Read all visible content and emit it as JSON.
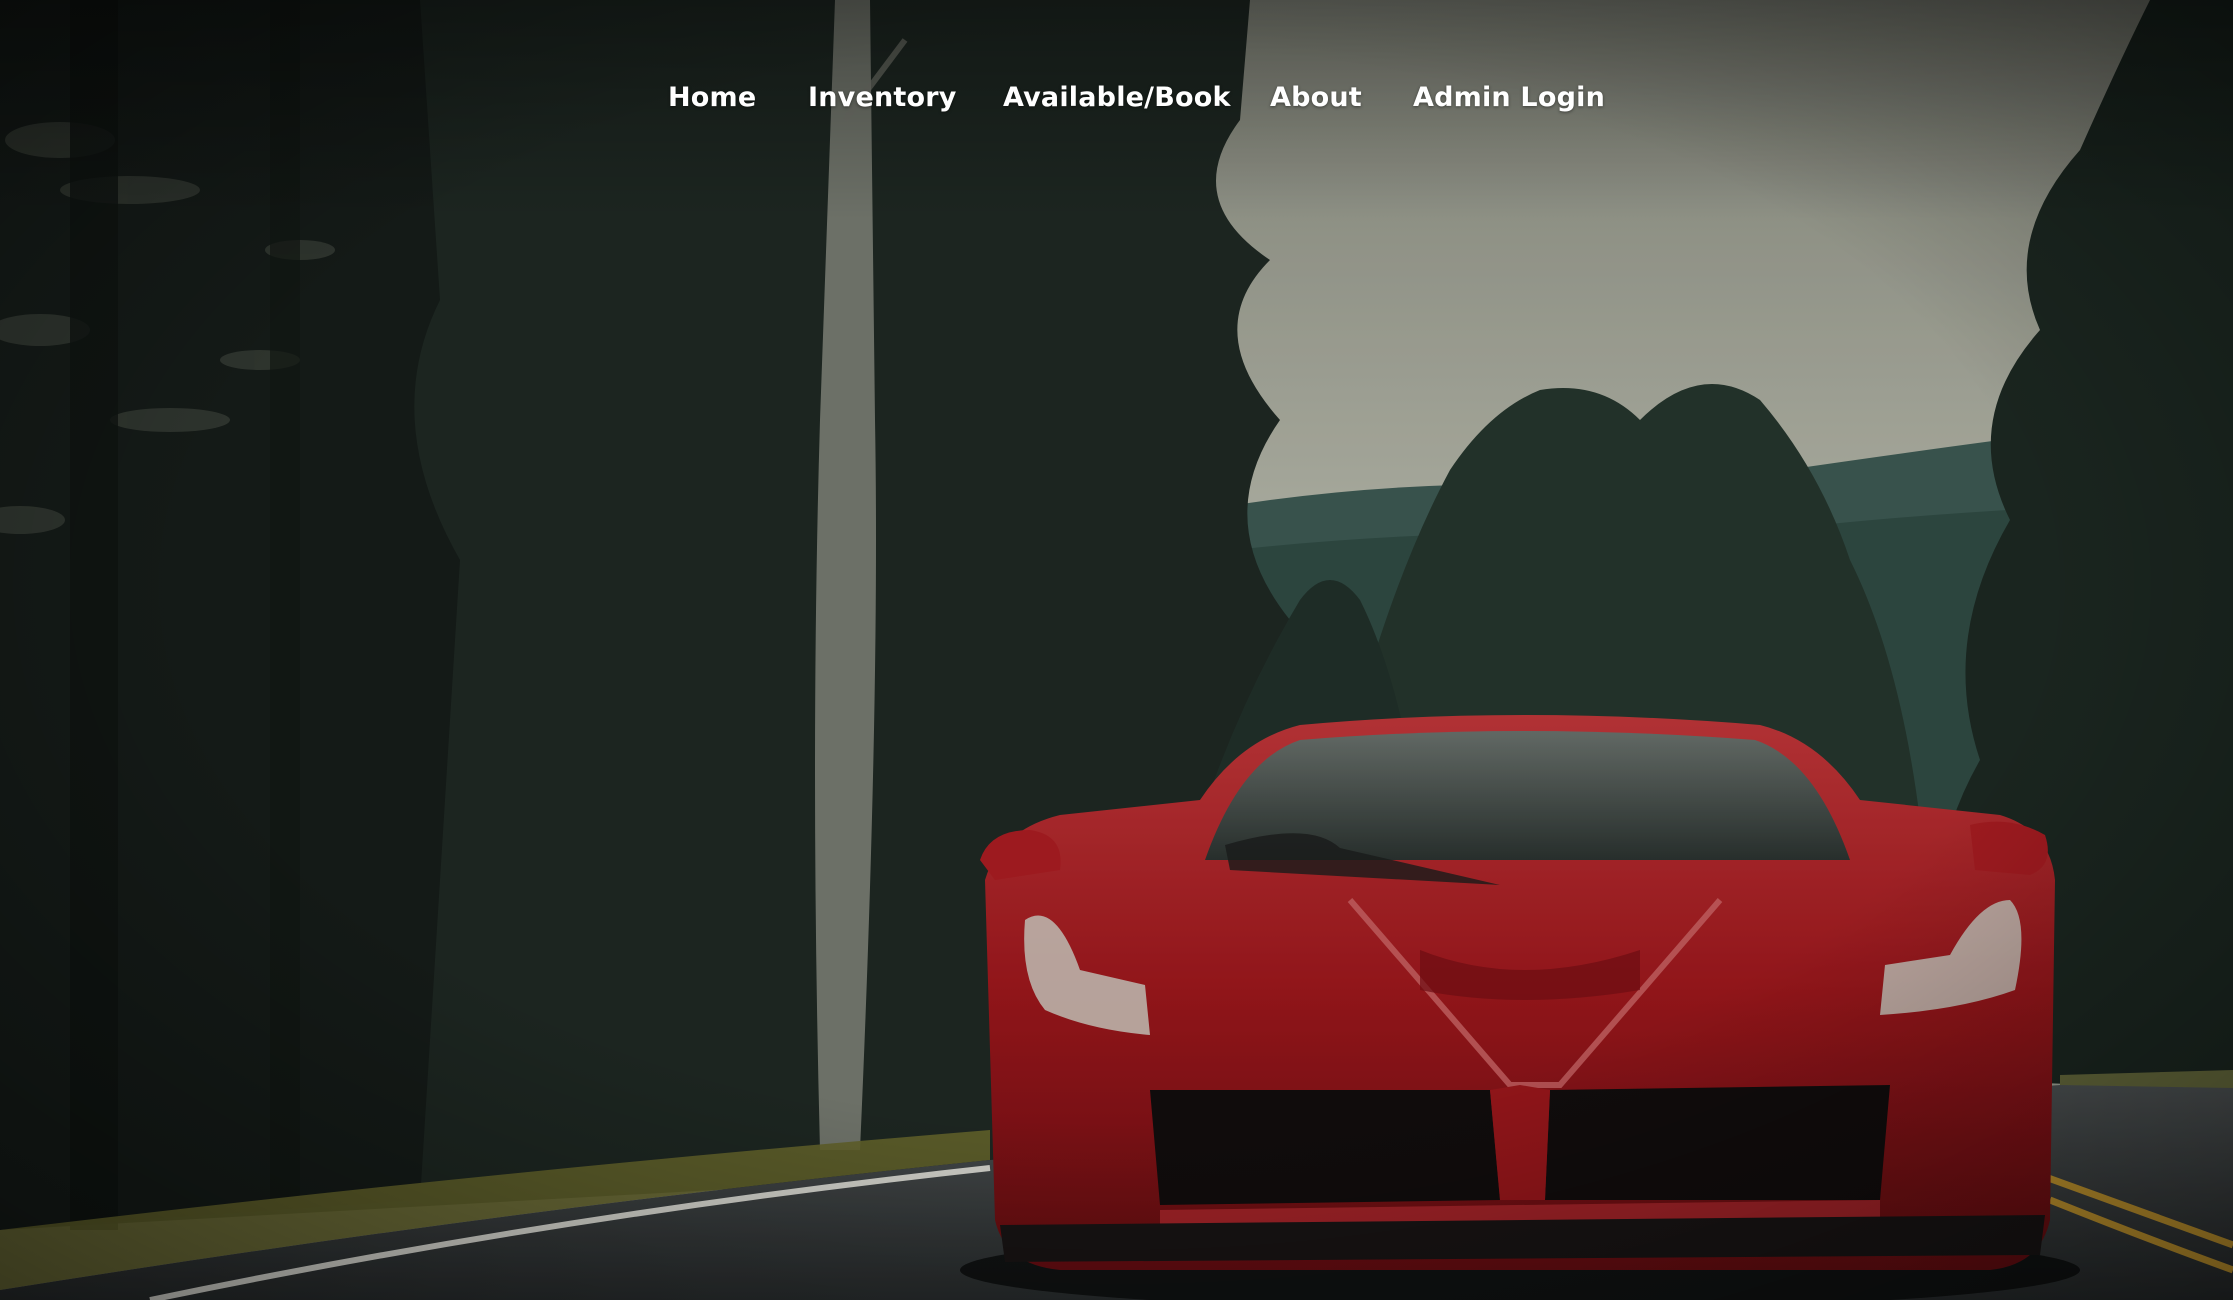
{
  "nav": {
    "items": [
      {
        "label": "Home"
      },
      {
        "label": "Inventory"
      },
      {
        "label": "Available/Book"
      },
      {
        "label": "About"
      },
      {
        "label": "Admin Login"
      }
    ]
  },
  "hero": {
    "background": "video of a red sports car driving on a forest road",
    "colors": {
      "car_red": "#a8191e",
      "forest_dark": "#1e2a22",
      "sky": "#b9bcae",
      "road": "#3a3d3f",
      "road_line_yellow": "#d9a531",
      "nav_text": "#ffffff"
    }
  }
}
